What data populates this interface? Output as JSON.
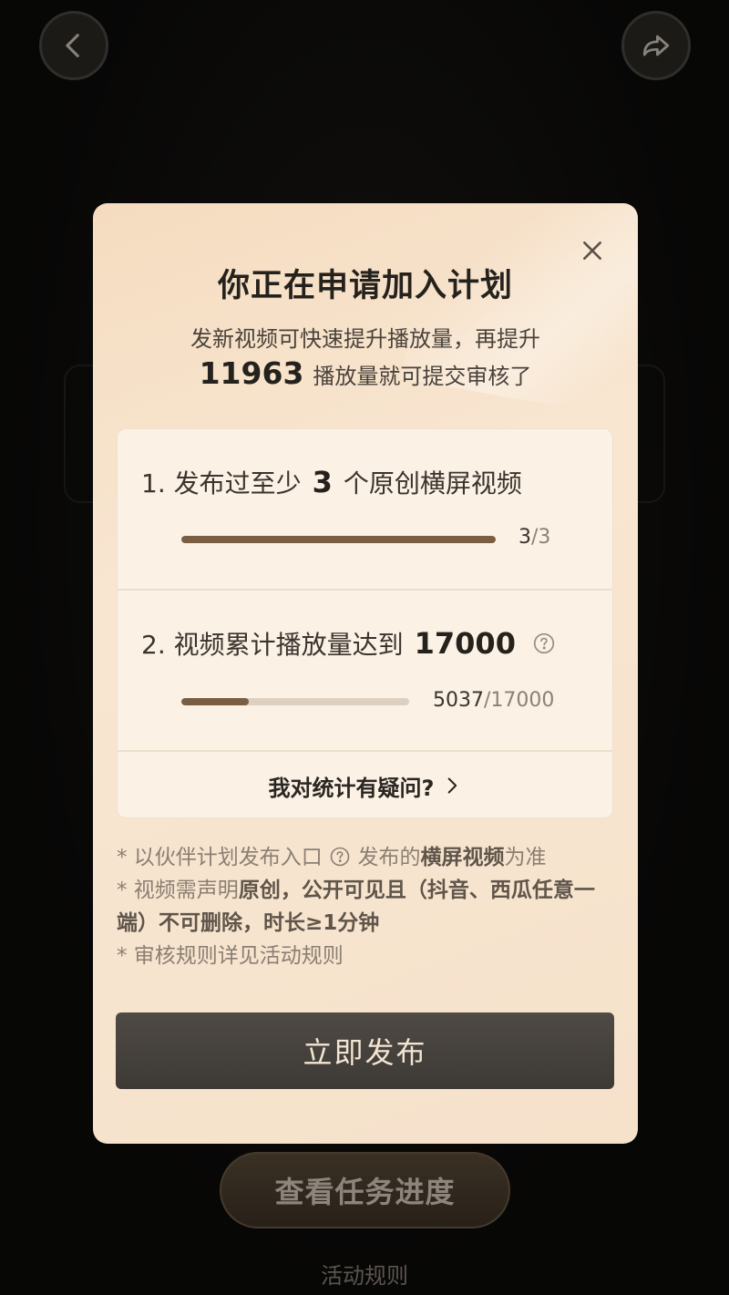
{
  "background": {
    "view_progress_button": "查看任务进度",
    "rules_link": "活动规则"
  },
  "modal": {
    "title": "你正在申请加入计划",
    "subtitle_line1": "发新视频可快速提升播放量，再提升",
    "subtitle_number": "11963",
    "subtitle_line2": "播放量就可提交审核了",
    "requirements": [
      {
        "prefix": "1. 发布过至少",
        "number": "3",
        "suffix": "个原创横屏视频",
        "current": "3",
        "total": "/3",
        "progress_fraction": 1.0
      },
      {
        "prefix": "2. 视频累计播放量达到",
        "number": "17000",
        "suffix": "",
        "current": "5037",
        "total": "/17000",
        "progress_fraction": 0.296
      }
    ],
    "question_link": "我对统计有疑问?",
    "notes": {
      "n1_a": "* 以伙伴计划发布入口",
      "n1_b": "发布的",
      "n1_bold": "横屏视频",
      "n1_c": "为准",
      "n2_a": "* 视频需声明",
      "n2_bold": "原创",
      "n2_b": "，公开可见且（抖音、西瓜任意一端）不可删除，时长≥1分钟",
      "n3": "* 审核规则详见活动规则"
    },
    "publish_button": "立即发布"
  },
  "colors": {
    "progress_fill": "#7a5e43",
    "button_dark": "#45413c",
    "modal_bg": "#f8e6d1"
  },
  "icons": [
    "back-arrow-icon",
    "share-arrow-icon",
    "close-icon",
    "help-circle-icon",
    "chevron-right-icon"
  ]
}
